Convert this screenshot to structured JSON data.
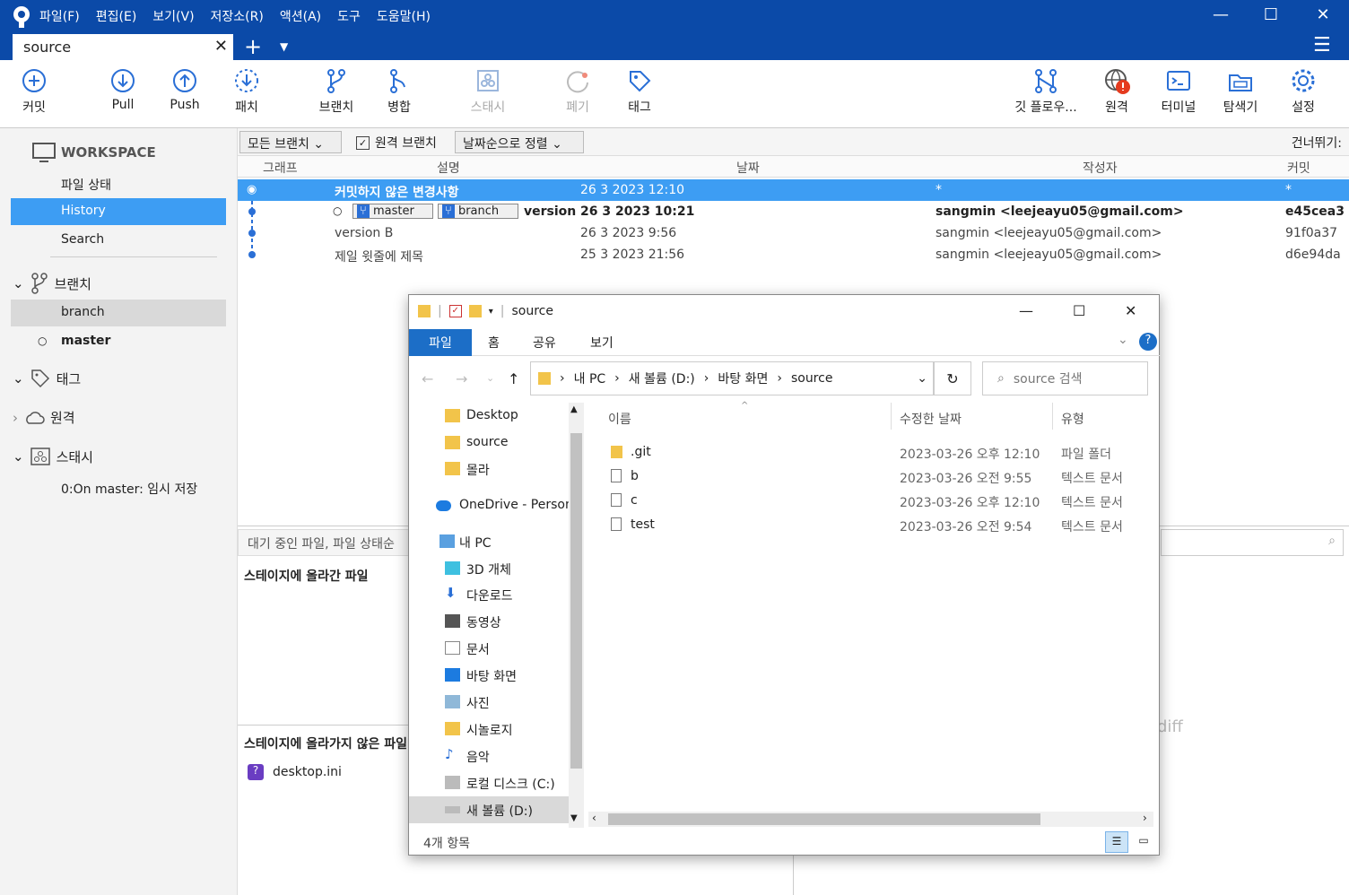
{
  "menu": [
    "파일(F)",
    "편집(E)",
    "보기(V)",
    "저장소(R)",
    "액션(A)",
    "도구",
    "도움말(H)"
  ],
  "tab": {
    "label": "source"
  },
  "toolbar": {
    "commit": "커밋",
    "pull": "Pull",
    "push": "Push",
    "patch": "패치",
    "branch": "브랜치",
    "merge": "병합",
    "stash": "스태시",
    "discard": "폐기",
    "tag": "태그",
    "gitflow": "깃 플로우...",
    "remote": "원격",
    "terminal": "터미널",
    "explorer": "탐색기",
    "settings": "설정"
  },
  "sidebar": {
    "workspace": "WORKSPACE",
    "file_status": "파일 상태",
    "history": "History",
    "search": "Search",
    "branches": "브랜치",
    "branch_items": [
      "branch",
      "master"
    ],
    "tags": "태그",
    "remotes": "원격",
    "stash": "스태시",
    "stash_item": "0:On master: 임시 저장"
  },
  "filter": {
    "branches": "모든 브랜치",
    "remote_branches": "원격 브랜치",
    "sort": "날짜순으로 정렬",
    "jump": "건너뛰기:"
  },
  "columns": {
    "graph": "그래프",
    "desc": "설명",
    "date": "날짜",
    "author": "작성자",
    "commit": "커밋"
  },
  "commits": [
    {
      "desc": "커밋하지 않은 변경사항",
      "date": "26 3 2023 12:10",
      "author": "*",
      "hash": "*"
    },
    {
      "desc": "version",
      "tags": [
        "master",
        "branch"
      ],
      "date": "26 3 2023 10:21",
      "author": "sangmin <leejeayu05@gmail.com>",
      "hash": "e45cea3"
    },
    {
      "desc": "version B",
      "date": "26 3 2023 9:56",
      "author": "sangmin <leejeayu05@gmail.com>",
      "hash": "91f0a37"
    },
    {
      "desc": "제일 윗줄에 제목",
      "date": "25 3 2023 21:56",
      "author": "sangmin <leejeayu05@gmail.com>",
      "hash": "d6e94da"
    }
  ],
  "lower": {
    "pending": "대기 중인 파일, 파일 상태순",
    "staged": "스테이지에 올라간 파일",
    "unstaged": "스테이지에 올라가지 않은 파일",
    "unstaged_file": "desktop.ini",
    "diff": "diff"
  },
  "explorer": {
    "title": "source",
    "ribbon": [
      "파일",
      "홈",
      "공유",
      "보기"
    ],
    "path": [
      "내 PC",
      "새 볼륨 (D:)",
      "바탕 화면",
      "source"
    ],
    "search_placeholder": "source 검색",
    "nav": [
      "Desktop",
      "source",
      "몰라",
      "OneDrive - Person",
      "내 PC",
      "3D 개체",
      "다운로드",
      "동영상",
      "문서",
      "바탕 화면",
      "사진",
      "시놀로지",
      "음악",
      "로컬 디스크 (C:)",
      "새 볼륨 (D:)"
    ],
    "columns": {
      "name": "이름",
      "modified": "수정한 날짜",
      "type": "유형"
    },
    "files": [
      {
        "name": ".git",
        "modified": "2023-03-26 오후 12:10",
        "type": "파일 폴더"
      },
      {
        "name": "b",
        "modified": "2023-03-26 오전 9:55",
        "type": "텍스트 문서"
      },
      {
        "name": "c",
        "modified": "2023-03-26 오후 12:10",
        "type": "텍스트 문서"
      },
      {
        "name": "test",
        "modified": "2023-03-26 오전 9:54",
        "type": "텍스트 문서"
      }
    ],
    "status": "4개 항목"
  },
  "colors": {
    "brand": "#0b4aa8",
    "selection": "#3d9df3",
    "toolbar_icon": "#2a6fd6",
    "alert": "#e53b1f"
  }
}
